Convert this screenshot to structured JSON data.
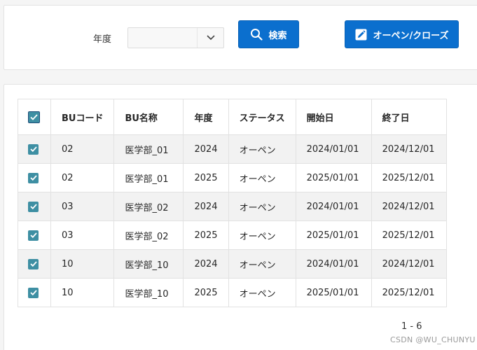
{
  "filter": {
    "year_label": "年度",
    "year_value": "",
    "search_button": "検索",
    "toggle_button": "オーペン/クローズ"
  },
  "table": {
    "headers": [
      "BUコード",
      "BU名称",
      "年度",
      "ステータス",
      "開始日",
      "終了日"
    ],
    "rows": [
      {
        "bu_code": "02",
        "bu_name": "医学部_01",
        "year": "2024",
        "status": "オーペン",
        "start": "2024/01/01",
        "end": "2024/12/01",
        "checked": true
      },
      {
        "bu_code": "02",
        "bu_name": "医学部_01",
        "year": "2025",
        "status": "オーペン",
        "start": "2025/01/01",
        "end": "2025/12/01",
        "checked": true
      },
      {
        "bu_code": "03",
        "bu_name": "医学部_02",
        "year": "2024",
        "status": "オーペン",
        "start": "2024/01/01",
        "end": "2024/12/01",
        "checked": true
      },
      {
        "bu_code": "03",
        "bu_name": "医学部_02",
        "year": "2025",
        "status": "オーペン",
        "start": "2025/01/01",
        "end": "2025/12/01",
        "checked": true
      },
      {
        "bu_code": "10",
        "bu_name": "医学部_10",
        "year": "2024",
        "status": "オーペン",
        "start": "2024/01/01",
        "end": "2024/12/01",
        "checked": true
      },
      {
        "bu_code": "10",
        "bu_name": "医学部_10",
        "year": "2025",
        "status": "オーペン",
        "start": "2025/01/01",
        "end": "2025/12/01",
        "checked": true
      }
    ]
  },
  "pagination": {
    "range": "1 - 6"
  },
  "watermark": "CSDN @WU_CHUNYU",
  "colors": {
    "primary_button": "#0b6fce",
    "checkbox": "#3e8fa3",
    "row_stripe": "#f2f2f2"
  },
  "icons": {
    "search": "search-icon",
    "edit": "edit-icon",
    "dropdown": "chevron-down-icon"
  }
}
